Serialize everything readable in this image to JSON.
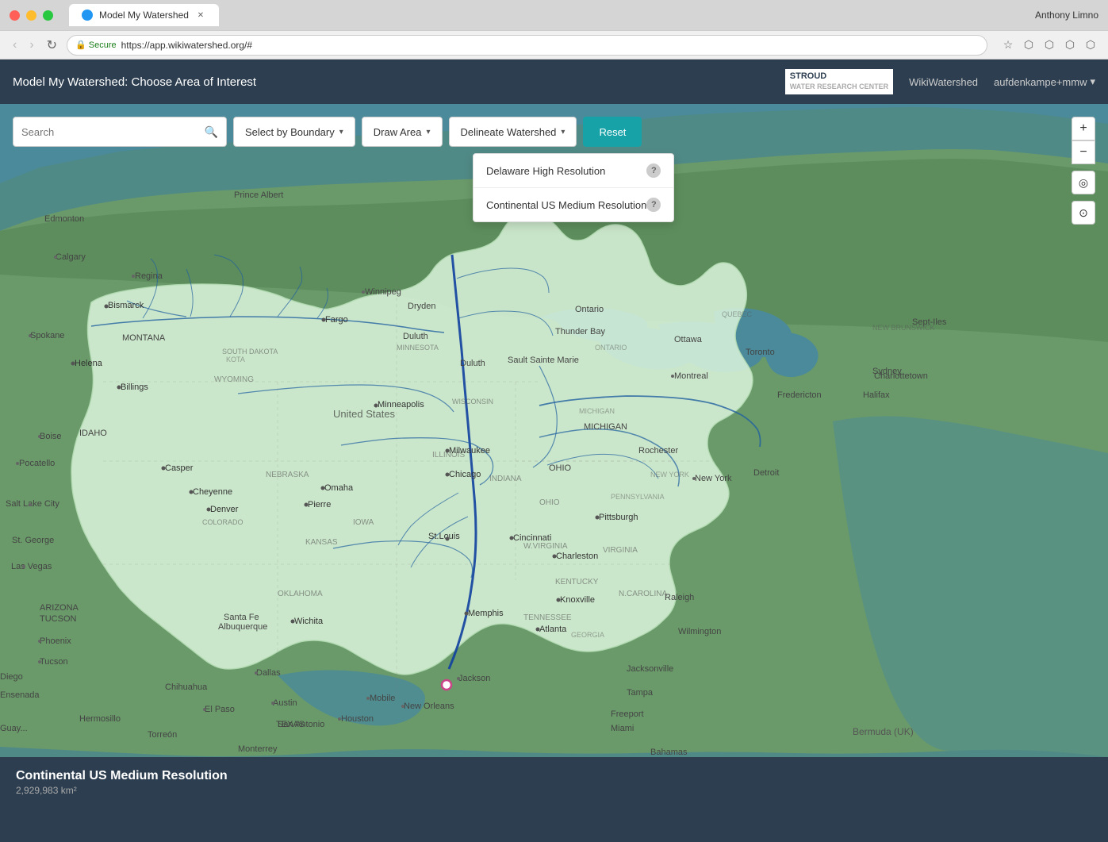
{
  "browser": {
    "tab_title": "Model My Watershed",
    "tab_new_label": "+",
    "address_protocol": "Secure",
    "address_url": "https://app.wikiwatershed.org/#",
    "user_name": "Anthony Limno"
  },
  "app": {
    "title": "Model My Watershed: Choose Area of Interest",
    "stroud_logo": "STROUD",
    "stroud_tagline": "WATER RESEARCH CENTER",
    "nav_wiki": "WikiWatershed",
    "nav_user": "aufdenkampe+mmw",
    "nav_user_caret": "▾"
  },
  "toolbar": {
    "search_placeholder": "Search",
    "search_icon": "🔍",
    "select_boundary_label": "Select by Boundary",
    "select_boundary_caret": "▾",
    "draw_area_label": "Draw Area",
    "draw_area_caret": "▾",
    "delineate_watershed_label": "Delineate Watershed",
    "delineate_watershed_caret": "▾",
    "reset_label": "Reset"
  },
  "dropdown": {
    "items": [
      {
        "label": "Delaware High Resolution",
        "info": "?"
      },
      {
        "label": "Continental US Medium Resolution",
        "info": "?"
      }
    ]
  },
  "map_controls": {
    "zoom_in": "+",
    "zoom_out": "−",
    "locate_icon": "◎",
    "bookmark_icon": "⊙"
  },
  "status_bar": {
    "title": "Continental US Medium Resolution",
    "subtitle": "2,929,983 km²"
  }
}
